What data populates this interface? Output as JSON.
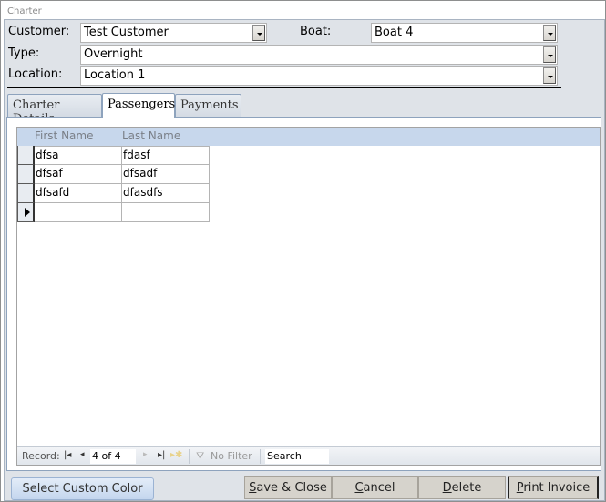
{
  "window": {
    "title": "Charter"
  },
  "header": {
    "customer": {
      "label": "Customer:",
      "value": "Test Customer"
    },
    "boat": {
      "label": "Boat:",
      "value": "Boat 4"
    },
    "type": {
      "label": "Type:",
      "value": "Overnight"
    },
    "location": {
      "label": "Location:",
      "value": "Location 1"
    }
  },
  "tabs": [
    {
      "label": "Charter Details",
      "active": false
    },
    {
      "label": "Passengers",
      "active": true
    },
    {
      "label": "Payments",
      "active": false
    }
  ],
  "grid": {
    "columns": [
      "First Name",
      "Last Name"
    ],
    "rows": [
      [
        "dfsa",
        "fdasf"
      ],
      [
        "dfsaf",
        "dfsadf"
      ],
      [
        "dfsafd",
        "dfasdfs"
      ],
      [
        "",
        ""
      ]
    ]
  },
  "navigator": {
    "record_label": "Record:",
    "position": "4 of 4",
    "filter_label": "No Filter",
    "search_placeholder": "Search"
  },
  "buttons": {
    "custom_color": "Select Custom Color",
    "save_close": {
      "underline": "S",
      "rest": "ave & Close"
    },
    "cancel": {
      "underline": "C",
      "rest": "ancel"
    },
    "delete": {
      "underline": "D",
      "rest": "elete"
    },
    "print_invoice": {
      "underline": "P",
      "rest": "rint Invoice"
    }
  }
}
